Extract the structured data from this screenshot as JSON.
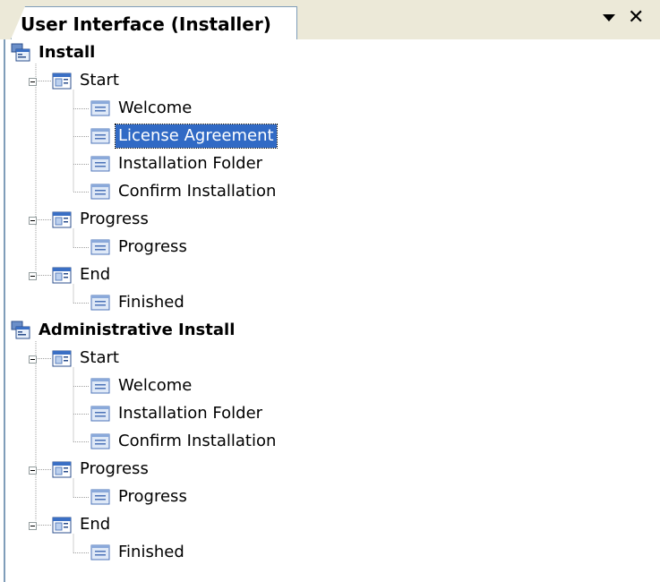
{
  "window": {
    "tab_title": "User Interface (Installer)",
    "dropdown_icon": "triangle-down-icon",
    "close_icon": "close-icon"
  },
  "colors": {
    "selection": "#316ac5",
    "tree_lines": "#a0a0a0",
    "border": "#7f9db9"
  },
  "tree": [
    {
      "label": "Install",
      "icon": "installer-root-icon",
      "children": [
        {
          "label": "Start",
          "icon": "dialog-group-icon",
          "children": [
            {
              "label": "Welcome",
              "icon": "dialog-icon"
            },
            {
              "label": "License Agreement",
              "icon": "dialog-icon",
              "selected": true
            },
            {
              "label": "Installation Folder",
              "icon": "dialog-icon"
            },
            {
              "label": "Confirm Installation",
              "icon": "dialog-icon"
            }
          ]
        },
        {
          "label": "Progress",
          "icon": "dialog-group-icon",
          "children": [
            {
              "label": "Progress",
              "icon": "dialog-icon"
            }
          ]
        },
        {
          "label": "End",
          "icon": "dialog-group-icon",
          "children": [
            {
              "label": "Finished",
              "icon": "dialog-icon"
            }
          ]
        }
      ]
    },
    {
      "label": "Administrative Install",
      "icon": "installer-root-icon",
      "children": [
        {
          "label": "Start",
          "icon": "dialog-group-icon",
          "children": [
            {
              "label": "Welcome",
              "icon": "dialog-icon"
            },
            {
              "label": "Installation Folder",
              "icon": "dialog-icon"
            },
            {
              "label": "Confirm Installation",
              "icon": "dialog-icon"
            }
          ]
        },
        {
          "label": "Progress",
          "icon": "dialog-group-icon",
          "children": [
            {
              "label": "Progress",
              "icon": "dialog-icon"
            }
          ]
        },
        {
          "label": "End",
          "icon": "dialog-group-icon",
          "children": [
            {
              "label": "Finished",
              "icon": "dialog-icon"
            }
          ]
        }
      ]
    }
  ]
}
